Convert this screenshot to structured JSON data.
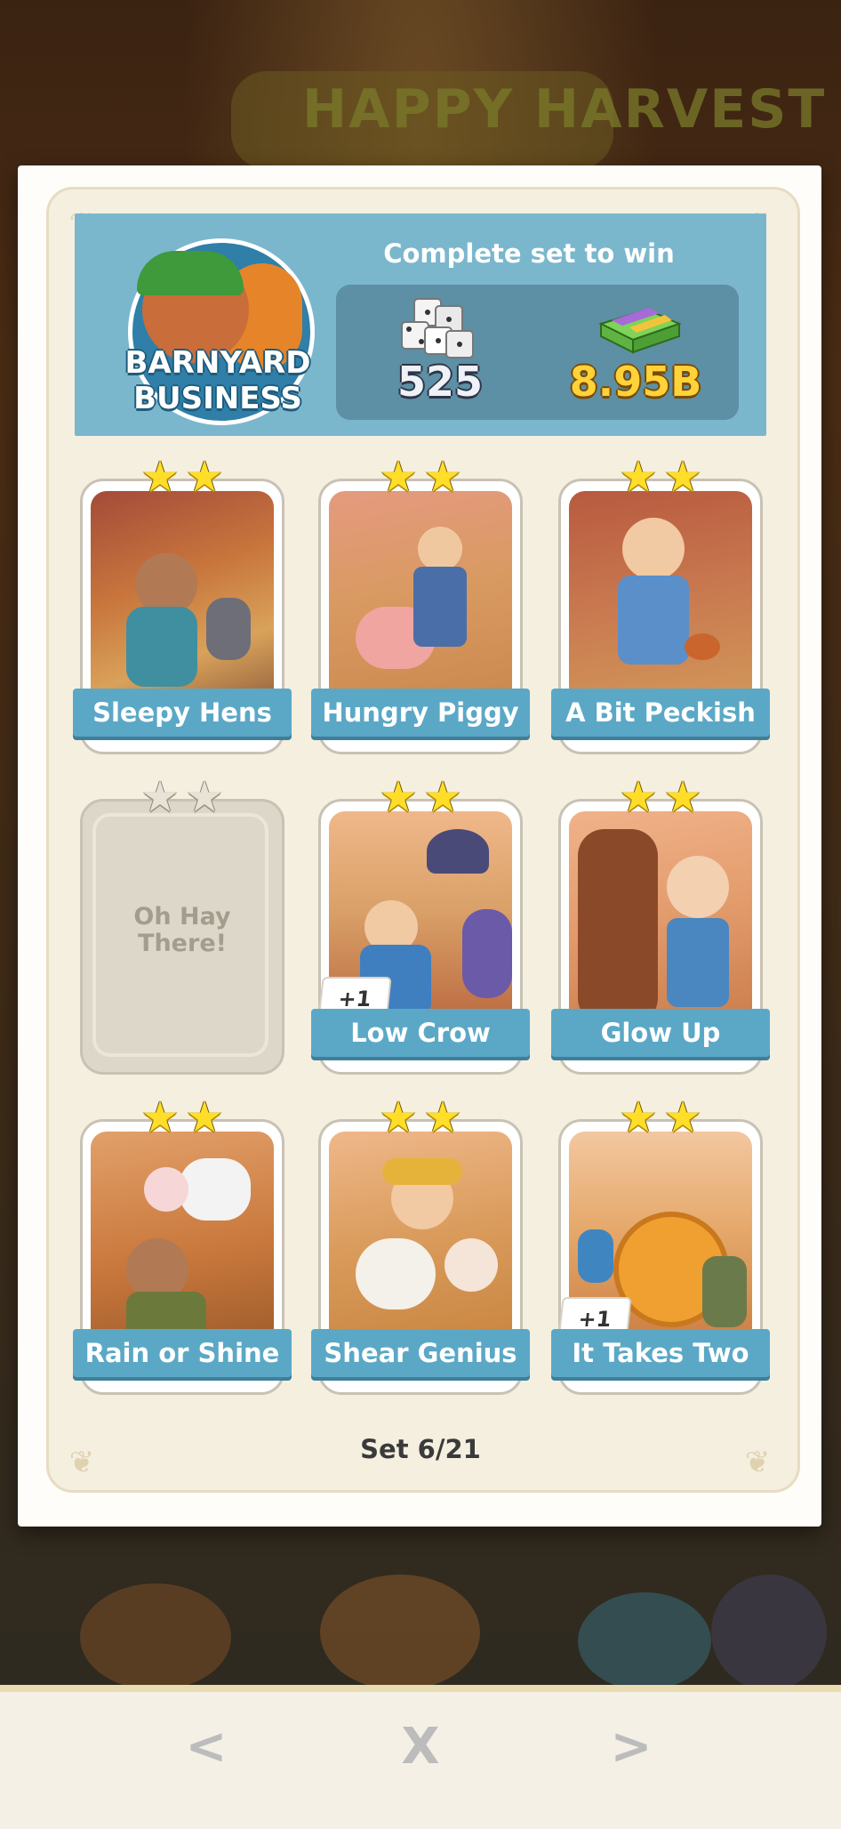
{
  "album": {
    "name_line1": "BARNYARD",
    "name_line2": "BUSINESS",
    "complete_label": "Complete set to win",
    "reward_dice": "525",
    "reward_cash": "8.95B"
  },
  "background_title": "HAPPY HARVEST",
  "stickers": [
    {
      "name": "Sleepy Hens",
      "stars": 2,
      "collected": true
    },
    {
      "name": "Hungry Piggy",
      "stars": 2,
      "collected": true
    },
    {
      "name": "A Bit Peckish",
      "stars": 2,
      "collected": true
    },
    {
      "name": "Oh Hay There!",
      "stars": 2,
      "collected": false
    },
    {
      "name": "Low Crow",
      "stars": 2,
      "collected": true,
      "badge": "+1"
    },
    {
      "name": "Glow Up",
      "stars": 2,
      "collected": true
    },
    {
      "name": "Rain or Shine",
      "stars": 2,
      "collected": true
    },
    {
      "name": "Shear Genius",
      "stars": 2,
      "collected": true
    },
    {
      "name": "It Takes Two",
      "stars": 2,
      "collected": true,
      "badge": "+1"
    }
  ],
  "missing_label_line1": "Oh Hay",
  "missing_label_line2": "There!",
  "set_count": "Set 6/21",
  "nav": {
    "prev": "<",
    "close": "X",
    "next": ">"
  },
  "icons": {
    "star": "★",
    "prev_icon": "chevron-left-icon",
    "close_icon": "close-icon",
    "next_icon": "chevron-right-icon"
  }
}
